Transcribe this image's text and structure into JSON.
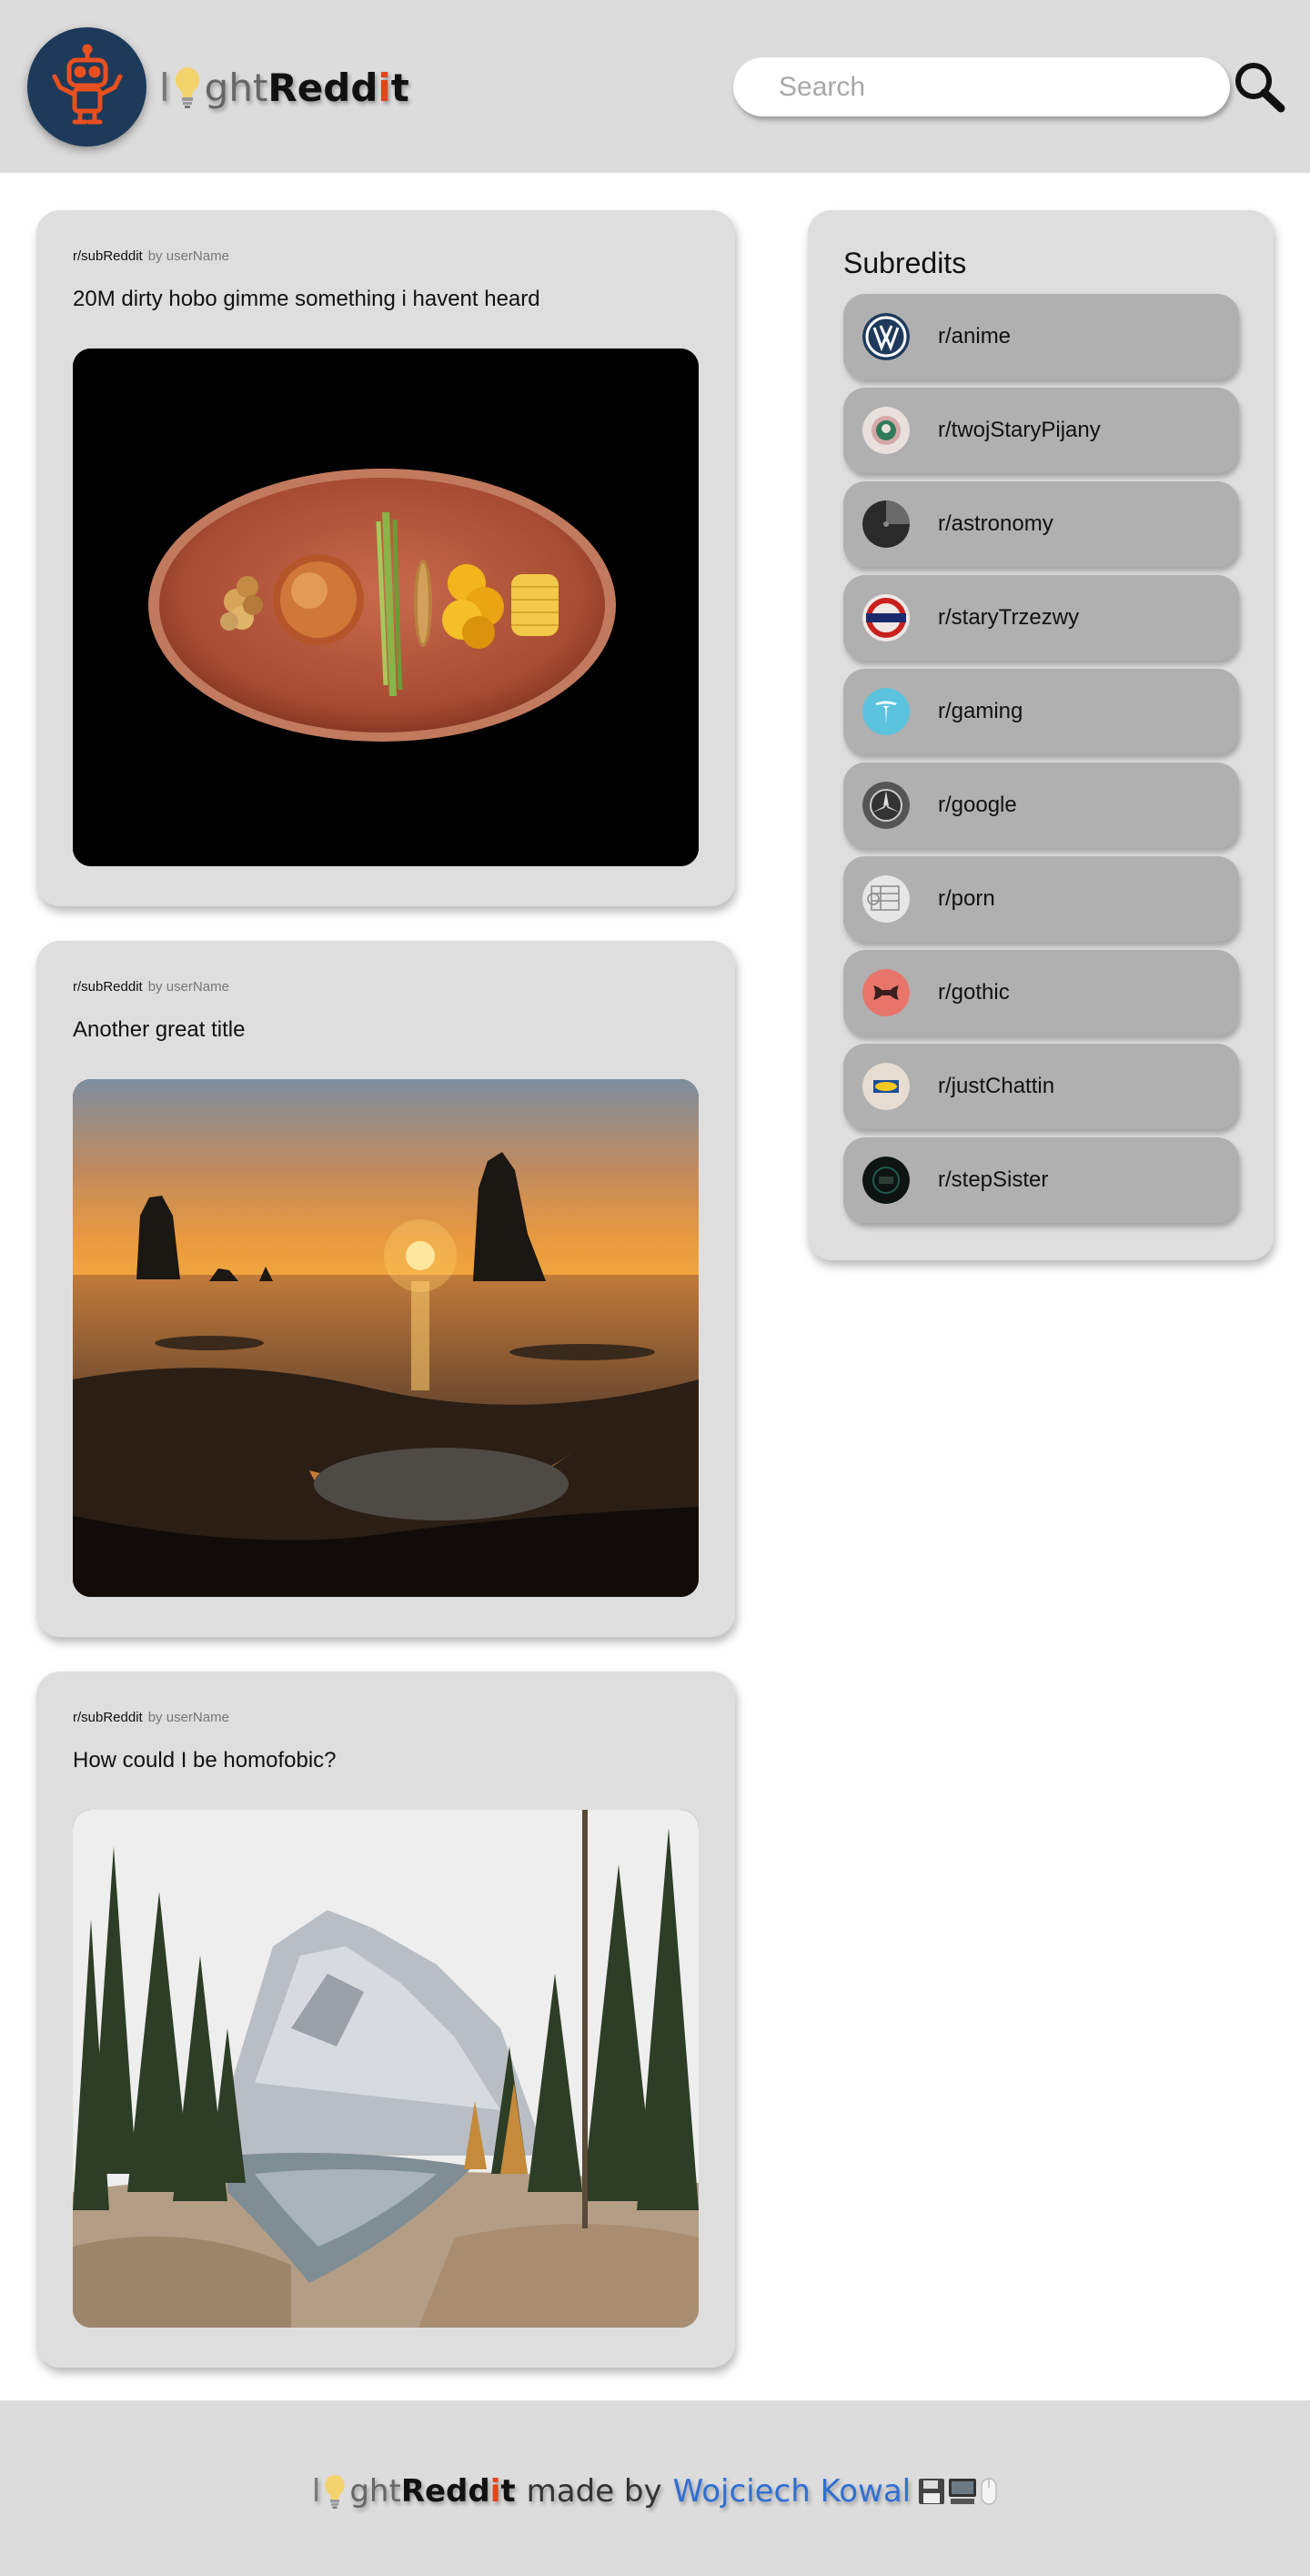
{
  "header": {
    "brand": {
      "part1": "l",
      "part2": "ght",
      "part3": "Redd",
      "part4": "i",
      "part5": "t"
    },
    "search": {
      "placeholder": "Search"
    },
    "logo_icon": "robot-icon",
    "search_icon": "magnifier-icon"
  },
  "posts": [
    {
      "subreddit": "r/subReddit",
      "author": "by userName",
      "title": "20M dirty hobo gimme something i havent heard",
      "image": "food-plate-photo"
    },
    {
      "subreddit": "r/subReddit",
      "author": "by userName",
      "title": "Another great title",
      "image": "sunset-sea-stacks-photo"
    },
    {
      "subreddit": "r/subReddit",
      "author": "by userName",
      "title": "How could I be homofobic?",
      "image": "mountain-lake-forest-photo"
    }
  ],
  "sidebar": {
    "title": "Subredits",
    "items": [
      {
        "label": "r/anime",
        "icon": "volkswagen-logo-icon"
      },
      {
        "label": "r/twojStaryPijany",
        "icon": "starbucks-logo-icon"
      },
      {
        "label": "r/astronomy",
        "icon": "dark-sphere-icon"
      },
      {
        "label": "r/staryTrzezwy",
        "icon": "roundel-sign-icon"
      },
      {
        "label": "r/gaming",
        "icon": "tesla-logo-icon"
      },
      {
        "label": "r/google",
        "icon": "mercedes-logo-icon"
      },
      {
        "label": "r/porn",
        "icon": "sketch-icon"
      },
      {
        "label": "r/gothic",
        "icon": "red-emblem-icon"
      },
      {
        "label": "r/justChattin",
        "icon": "ikea-logo-icon"
      },
      {
        "label": "r/stepSister",
        "icon": "dark-badge-icon"
      }
    ]
  },
  "footer": {
    "made_by": "made by",
    "author": "Wojciech Kowal",
    "device_icons": [
      "floppy-disk-icon",
      "computer-icon",
      "mouse-icon"
    ]
  },
  "colors": {
    "header_bg": "#dcdcdc",
    "card_bg": "#dedede",
    "sidebar_item_bg": "#b0b0b0",
    "accent_orange": "#e0461c",
    "link_blue": "#2f6fd4",
    "logo_circle": "#1e3a5a"
  }
}
